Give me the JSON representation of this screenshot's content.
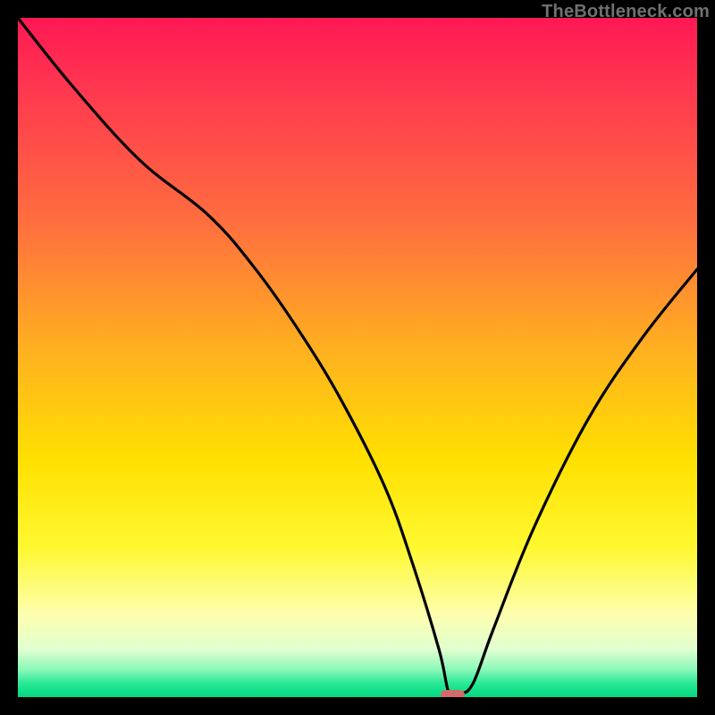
{
  "watermark": "TheBottleneck.com",
  "colors": {
    "frame": "#000000",
    "curve_stroke": "#000000",
    "marker_fill": "#d46a6a",
    "watermark_color": "#707070"
  },
  "chart_data": {
    "type": "line",
    "title": "",
    "xlabel": "",
    "ylabel": "",
    "xlim": [
      0,
      100
    ],
    "ylim": [
      0,
      100
    ],
    "grid": false,
    "legend": false,
    "background": "rainbow-gradient (red top → green bottom)",
    "series": [
      {
        "name": "bottleneck-curve",
        "x": [
          0,
          8,
          18,
          28,
          35,
          42,
          48,
          54,
          58,
          62,
          63.5,
          65,
          67,
          70,
          76,
          84,
          92,
          100
        ],
        "y": [
          100,
          90,
          79,
          71,
          63,
          53,
          43,
          31,
          20,
          7,
          0.5,
          0.5,
          2,
          10,
          25,
          41,
          53,
          63
        ]
      }
    ],
    "annotations": [
      {
        "name": "minimum-marker",
        "shape": "rounded-rect",
        "center_x": 64,
        "center_y": 0.4,
        "width_pct": 3.5,
        "height_pct": 1.4,
        "color": "#d46a6a"
      }
    ]
  }
}
